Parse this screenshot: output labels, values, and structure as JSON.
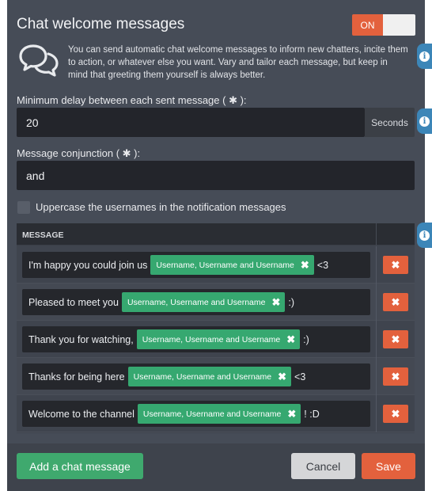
{
  "header": {
    "title": "Chat welcome messages",
    "toggle_label": "ON"
  },
  "intro": {
    "text": "You can send automatic chat welcome messages to inform new chatters, incite them to action, or whatever else you want. Vary and tailor each message, but keep in mind that greeting them yourself is always better.",
    "icon": "chat-bubbles-icon"
  },
  "delay": {
    "label": "Minimum delay between each sent message ( ✱ ):",
    "value": "20",
    "suffix": "Seconds"
  },
  "conjunction": {
    "label": "Message conjunction ( ✱ ):",
    "value": "and"
  },
  "uppercase": {
    "label": "Uppercase the usernames in the notification messages",
    "checked": false
  },
  "table": {
    "header": "MESSAGE",
    "rows": [
      {
        "before": "I'm happy you could join us",
        "tag": "Username, Username and Username",
        "after": "<3"
      },
      {
        "before": "Pleased to meet you",
        "tag": "Username, Username and Username",
        "after": ":)"
      },
      {
        "before": "Thank you for watching,",
        "tag": "Username, Username and Username",
        "after": ":)"
      },
      {
        "before": "Thanks for being here",
        "tag": "Username, Username and Username",
        "after": "<3"
      },
      {
        "before": "Welcome to the channel",
        "tag": "Username, Username and Username",
        "after": "! :D"
      }
    ],
    "tag_remove_glyph": "✖",
    "delete_glyph": "✖"
  },
  "footer": {
    "add_label": "Add a chat message",
    "cancel_label": "Cancel",
    "save_label": "Save"
  },
  "colors": {
    "panel": "#464c57",
    "accent_orange": "#e3613d",
    "accent_green": "#3fa96e",
    "info_blue": "#3c86b8"
  }
}
